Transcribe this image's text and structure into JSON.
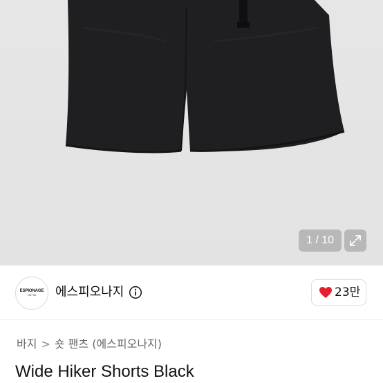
{
  "gallery": {
    "counter": "1 / 10",
    "expand_icon": "expand-arrows-icon"
  },
  "seller": {
    "name": "에스피오나지",
    "logo_text": "ESPIONAGE",
    "logo_subtext": "NST 06",
    "info_icon": "info-circle-icon"
  },
  "like": {
    "icon": "heart-icon",
    "count": "23만",
    "color": "#e5202e"
  },
  "breadcrumb": {
    "items": [
      "바지",
      "숏 팬츠",
      "(에스피오나지)"
    ],
    "separator": ">"
  },
  "product": {
    "title": "Wide Hiker Shorts Black"
  }
}
